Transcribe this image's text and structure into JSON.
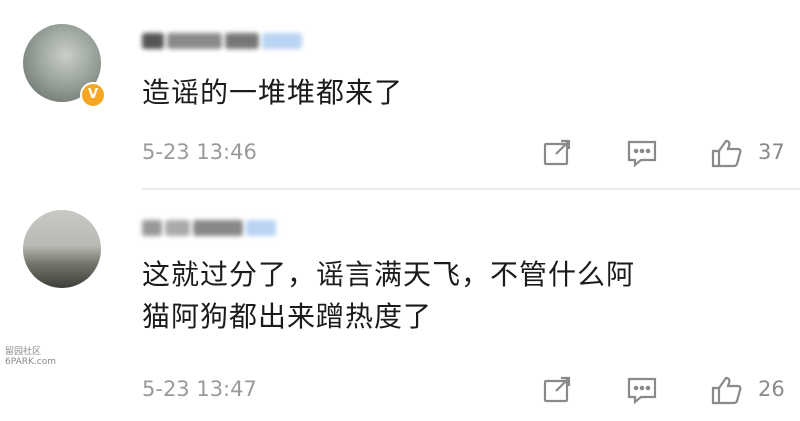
{
  "comments": [
    {
      "content": "造谣的一堆堆都来了",
      "time": "5-23 13:46",
      "likes": "37",
      "verified_badge": "V",
      "avatar_icon": "user-avatar-photo"
    },
    {
      "content_line1": "这就过分了，谣言满天飞，不管什么阿",
      "content_line2": "猫阿狗都出来蹭热度了",
      "time": "5-23 13:47",
      "likes": "26",
      "avatar_icon": "user-avatar-photo"
    }
  ],
  "icons": {
    "share": "share-icon",
    "reply": "comment-icon",
    "like": "thumbs-up-icon"
  },
  "colors": {
    "text": "#1b1b1b",
    "meta": "#9a9a9a",
    "badge": "#f5a623",
    "blurred_name_accent": "#b9d3f2"
  },
  "watermark": {
    "line1": "留园社区",
    "line2": "6PARK.com"
  }
}
